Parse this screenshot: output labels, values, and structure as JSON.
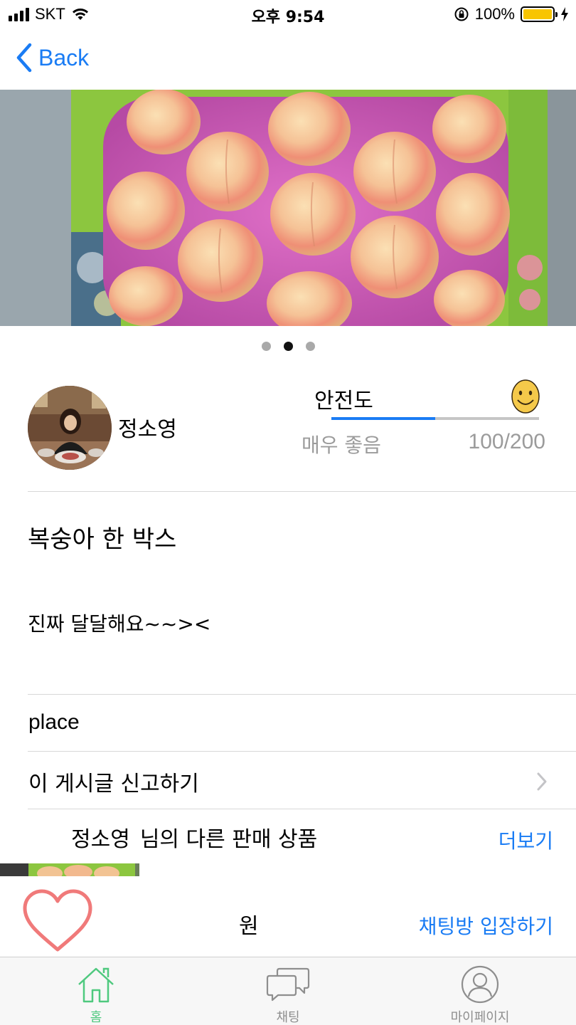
{
  "status_bar": {
    "carrier": "SKT",
    "time": "오후 9:54",
    "battery_percent": "100%"
  },
  "nav": {
    "back_label": "Back",
    "back_icon": "chevron-left-icon"
  },
  "gallery": {
    "image_description_icon": "peach-box-photo",
    "page_count": 3,
    "active_page": 2
  },
  "seller": {
    "name": "정소영",
    "avatar_icon": "user-photo"
  },
  "safety": {
    "label": "안전도",
    "grade": "매우 좋음",
    "score_text": "100/200",
    "score_fraction": 0.5,
    "icon": "smiley-icon"
  },
  "post": {
    "title": "복숭아 한 박스",
    "body": "진짜 달달해요~~><",
    "place": "place"
  },
  "report": {
    "label": "이 게시글 신고하기"
  },
  "other_products": {
    "seller_name": "정소영",
    "suffix": "님의 다른 판매 상품",
    "more_label": "더보기"
  },
  "action_bar": {
    "price": "원",
    "chat_button": "채팅방 입장하기"
  },
  "tabs": [
    {
      "label": "홈",
      "icon": "home-icon",
      "active": true
    },
    {
      "label": "채팅",
      "icon": "chat-bubbles-icon",
      "active": false
    },
    {
      "label": "마이페이지",
      "icon": "person-icon",
      "active": false
    }
  ],
  "colors": {
    "accent": "#1a7cf4",
    "heart": "#f07a7a",
    "tab_active": "#4fc97f",
    "battery": "#f8c500"
  }
}
